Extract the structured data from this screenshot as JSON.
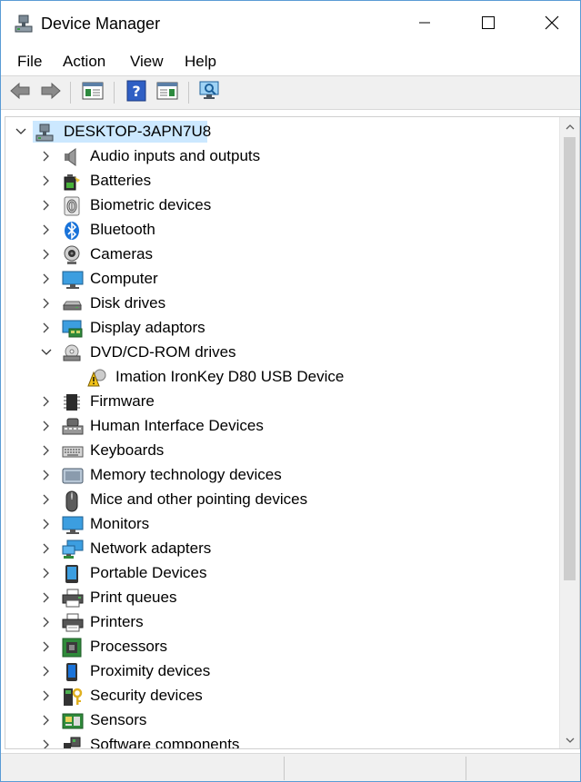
{
  "window": {
    "title": "Device Manager",
    "controls": [
      "minimize-icon",
      "maximize-icon",
      "close-icon"
    ]
  },
  "menu": {
    "items": [
      {
        "label": "File"
      },
      {
        "label": "Action"
      },
      {
        "label": "View"
      },
      {
        "label": "Help"
      }
    ]
  },
  "toolbar": {
    "buttons": [
      "back-arrow-icon",
      "forward-arrow-icon",
      "properties-icon",
      "help-icon",
      "scan-changes-icon",
      "monitor-scan-icon"
    ]
  },
  "tree": {
    "root": {
      "label": "DESKTOP-3APN7U8",
      "expanded": true
    },
    "items": [
      {
        "label": "Audio inputs and outputs",
        "icon": "speaker-icon",
        "expanded": false
      },
      {
        "label": "Batteries",
        "icon": "battery-icon",
        "expanded": false
      },
      {
        "label": "Biometric devices",
        "icon": "fingerprint-icon",
        "expanded": false
      },
      {
        "label": "Bluetooth",
        "icon": "bluetooth-icon",
        "expanded": false
      },
      {
        "label": "Cameras",
        "icon": "webcam-icon",
        "expanded": false
      },
      {
        "label": "Computer",
        "icon": "computer-icon",
        "expanded": false
      },
      {
        "label": "Disk drives",
        "icon": "disk-drive-icon",
        "expanded": false
      },
      {
        "label": "Display adaptors",
        "icon": "display-adapter-icon",
        "expanded": false
      },
      {
        "label": "DVD/CD-ROM drives",
        "icon": "dvd-drive-icon",
        "expanded": true,
        "children": [
          {
            "label": "Imation IronKey D80 USB Device",
            "icon": "warning-usb-icon"
          }
        ]
      },
      {
        "label": "Firmware",
        "icon": "firmware-chip-icon",
        "expanded": false
      },
      {
        "label": "Human Interface Devices",
        "icon": "hid-icon",
        "expanded": false
      },
      {
        "label": "Keyboards",
        "icon": "keyboard-icon",
        "expanded": false
      },
      {
        "label": "Memory technology devices",
        "icon": "memory-device-icon",
        "expanded": false
      },
      {
        "label": "Mice and other pointing devices",
        "icon": "mouse-icon",
        "expanded": false
      },
      {
        "label": "Monitors",
        "icon": "monitor-icon",
        "expanded": false
      },
      {
        "label": "Network adapters",
        "icon": "network-adapter-icon",
        "expanded": false
      },
      {
        "label": "Portable Devices",
        "icon": "portable-device-icon",
        "expanded": false
      },
      {
        "label": "Print queues",
        "icon": "print-queue-icon",
        "expanded": false
      },
      {
        "label": "Printers",
        "icon": "printer-icon",
        "expanded": false
      },
      {
        "label": "Processors",
        "icon": "processor-icon",
        "expanded": false
      },
      {
        "label": "Proximity devices",
        "icon": "proximity-device-icon",
        "expanded": false
      },
      {
        "label": "Security devices",
        "icon": "security-device-icon",
        "expanded": false
      },
      {
        "label": "Sensors",
        "icon": "sensor-icon",
        "expanded": false
      },
      {
        "label": "Software components",
        "icon": "software-component-icon",
        "expanded": false
      }
    ]
  },
  "colors": {
    "selection": "#cce8ff",
    "window_border": "#5a9bd5",
    "accent_blue": "#1a73d9"
  }
}
